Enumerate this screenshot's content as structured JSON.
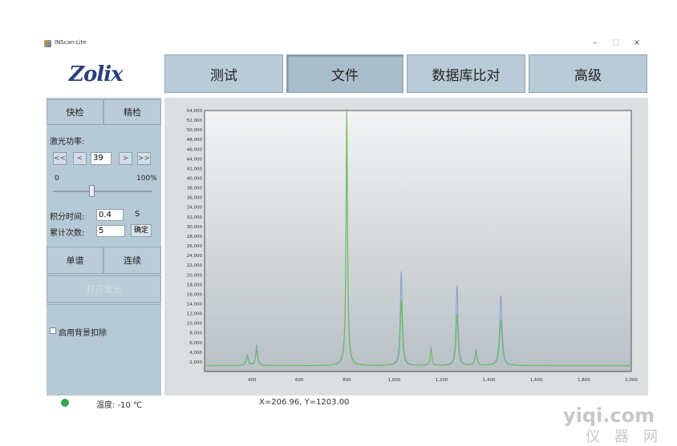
{
  "window": {
    "title": "INScan-Lite",
    "buttons": {
      "minimize": "–",
      "maximize": "□",
      "close": "×"
    }
  },
  "logo": {
    "text": "Zolix",
    "color": "#2a3f7a"
  },
  "nav": {
    "tabs": [
      {
        "label": "测试"
      },
      {
        "label": "文件",
        "active": true
      },
      {
        "label": "数据库比对"
      },
      {
        "label": "高级"
      }
    ]
  },
  "sidebar": {
    "mode_buttons": {
      "quick": "快检",
      "fine": "精检"
    },
    "laser_power": {
      "label": "激光功率:",
      "value": "39",
      "btn_first": "<<",
      "btn_prev": "<",
      "btn_next": ">",
      "btn_last": ">>",
      "min_label": "0",
      "max_label": "100%",
      "slider_fraction": 0.39
    },
    "integration": {
      "label": "积分时间:",
      "value": "0.4",
      "unit": "S"
    },
    "accumulate": {
      "label": "累计次数:",
      "value": "5",
      "confirm": "确定"
    },
    "scan_buttons": {
      "single": "单谱",
      "continuous": "连续"
    },
    "open_laser": "打开激光",
    "background": {
      "label": "启用背景扣除",
      "checked": false
    }
  },
  "status": {
    "temperature": "温度: -10 ℃",
    "coords": "X=206.96, Y=1203.00",
    "indicator_color": "#2fa84a"
  },
  "watermark": {
    "line1": "yiqi.com",
    "line2": "仪器网"
  },
  "chart_data": {
    "type": "line",
    "xlim": [
      200,
      2000
    ],
    "ylim": [
      0,
      54000
    ],
    "x_ticks": [
      "400",
      "600",
      "800",
      "1,000",
      "1,200",
      "1,400",
      "1,600",
      "1,800",
      "2,000"
    ],
    "y_ticks": [
      "2,000",
      "4,000",
      "6,000",
      "8,000",
      "10,000",
      "12,000",
      "14,000",
      "16,000",
      "18,000",
      "20,000",
      "22,000",
      "24,000",
      "26,000",
      "28,000",
      "30,000",
      "32,000",
      "34,000",
      "36,000",
      "38,000",
      "40,000",
      "42,000",
      "44,000",
      "46,000",
      "48,000",
      "50,000",
      "52,000",
      "54,000"
    ],
    "baseline": 1200,
    "series": [
      {
        "color": "#7aa2d0",
        "peaks": [
          {
            "x": 380,
            "h": 2200,
            "w": 6
          },
          {
            "x": 420,
            "h": 4200,
            "w": 5
          },
          {
            "x": 800,
            "h": 44000,
            "w": 4
          },
          {
            "x": 1030,
            "h": 19500,
            "w": 5
          },
          {
            "x": 1155,
            "h": 3800,
            "w": 4
          },
          {
            "x": 1265,
            "h": 16500,
            "w": 5
          },
          {
            "x": 1345,
            "h": 3300,
            "w": 5
          },
          {
            "x": 1450,
            "h": 14500,
            "w": 6
          }
        ]
      },
      {
        "color": "#6ac24f",
        "peaks": [
          {
            "x": 380,
            "h": 1600,
            "w": 6
          },
          {
            "x": 420,
            "h": 3200,
            "w": 5
          },
          {
            "x": 800,
            "h": 53000,
            "w": 4
          },
          {
            "x": 1030,
            "h": 13500,
            "w": 5
          },
          {
            "x": 1155,
            "h": 3300,
            "w": 4
          },
          {
            "x": 1265,
            "h": 10500,
            "w": 5
          },
          {
            "x": 1345,
            "h": 2600,
            "w": 5
          },
          {
            "x": 1450,
            "h": 9500,
            "w": 6
          }
        ]
      }
    ]
  }
}
